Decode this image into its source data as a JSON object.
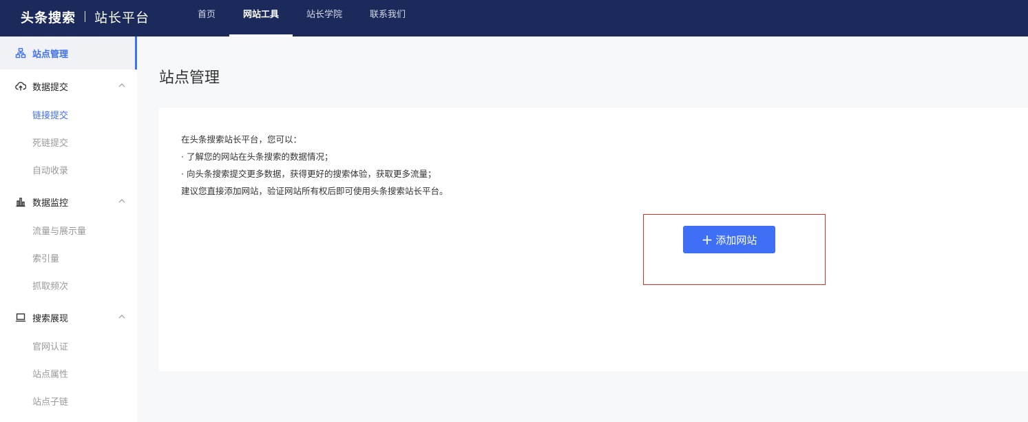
{
  "brand": {
    "name": "头条搜索",
    "sub": "站长平台"
  },
  "nav": [
    {
      "label": "首页",
      "active": false
    },
    {
      "label": "网站工具",
      "active": true
    },
    {
      "label": "站长学院",
      "active": false
    },
    {
      "label": "联系我们",
      "active": false
    }
  ],
  "sidebar": {
    "site_manage": "站点管理",
    "data_submit": {
      "label": "数据提交",
      "items": [
        "链接提交",
        "死链提交",
        "自动收录"
      ]
    },
    "data_monitor": {
      "label": "数据监控",
      "items": [
        "流量与展示量",
        "索引量",
        "抓取频次"
      ]
    },
    "search_display": {
      "label": "搜索展现",
      "items": [
        "官网认证",
        "站点属性",
        "站点子链"
      ]
    }
  },
  "main": {
    "title": "站点管理",
    "intro": [
      "在头条搜索站长平台，您可以：",
      "· 了解您的网站在头条搜索的数据情况；",
      "· 向头条搜索提交更多数据，获得更好的搜索体验，获取更多流量；",
      "建议您直接添加网站，验证网站所有权后即可使用头条搜索站长平台。"
    ],
    "add_button": {
      "icon": "+",
      "label": "添加网站"
    }
  },
  "colors": {
    "topbar": "#1b2a5a",
    "accent": "#3f6ff5",
    "highlight_border": "#d93025"
  }
}
